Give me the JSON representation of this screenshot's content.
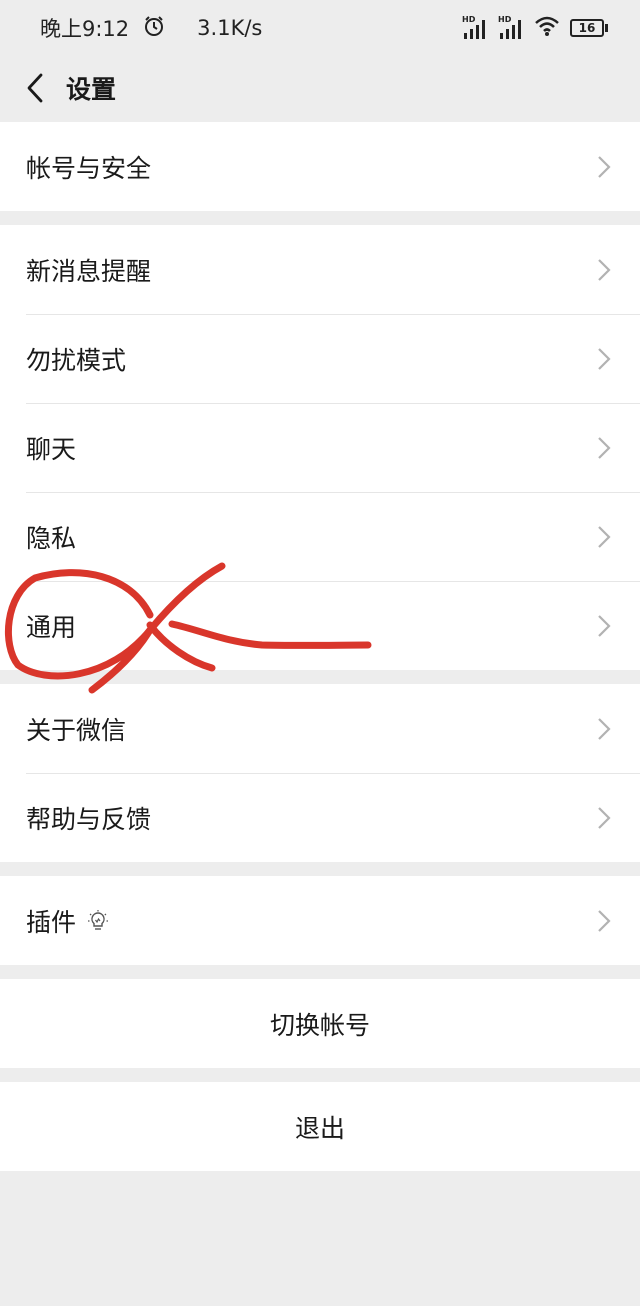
{
  "status_bar": {
    "time": "晚上9:12",
    "net_speed": "3.1K/s",
    "hd1": "HD",
    "hd2": "HD",
    "battery": "16",
    "icons": [
      "alarm-icon",
      "signal-icon",
      "wifi-icon",
      "battery-icon"
    ]
  },
  "nav": {
    "title": "设置",
    "back_icon": "chevron-left-icon"
  },
  "groups": [
    {
      "items": [
        {
          "label": "帐号与安全"
        }
      ]
    },
    {
      "items": [
        {
          "label": "新消息提醒"
        },
        {
          "label": "勿扰模式"
        },
        {
          "label": "聊天"
        },
        {
          "label": "隐私"
        },
        {
          "label": "通用"
        }
      ]
    },
    {
      "items": [
        {
          "label": "关于微信"
        },
        {
          "label": "帮助与反馈"
        }
      ]
    },
    {
      "items": [
        {
          "label": "插件",
          "icon": "lightbulb-icon"
        }
      ]
    }
  ],
  "actions": {
    "switch_account": "切换帐号",
    "logout": "退出"
  },
  "colors": {
    "background": "#ededed",
    "card": "#ffffff",
    "annotation": "#d9362b",
    "chevron": "#b2b2b2"
  }
}
